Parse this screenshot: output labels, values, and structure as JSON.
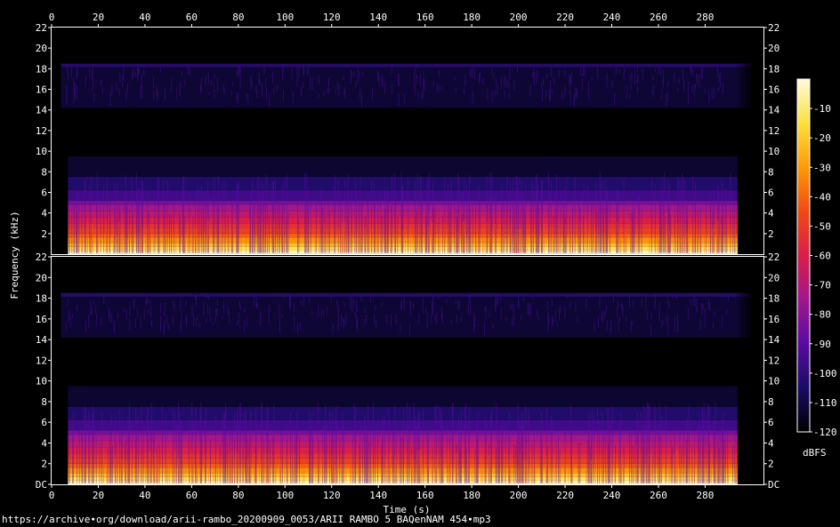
{
  "chart_data": {
    "type": "heatmap",
    "title": "",
    "xlabel": "Time (s)",
    "ylabel": "Frequency (kHz)",
    "xlim": [
      0,
      305
    ],
    "x_ticks": [
      0,
      20,
      40,
      60,
      80,
      100,
      120,
      140,
      160,
      180,
      200,
      220,
      240,
      260,
      280
    ],
    "channels": [
      {
        "name": "upper",
        "ylim": [
          0,
          22
        ],
        "y_ticks": [
          "2",
          "4",
          "6",
          "8",
          "10",
          "12",
          "14",
          "16",
          "18",
          "20",
          "22"
        ],
        "y_ticks_right": [
          "2",
          "4",
          "6",
          "8",
          "10",
          "12",
          "14",
          "16",
          "18",
          "20",
          "22"
        ]
      },
      {
        "name": "lower",
        "ylim": [
          0,
          22
        ],
        "y_ticks": [
          "DC",
          "2",
          "4",
          "6",
          "8",
          "10",
          "12",
          "14",
          "16",
          "18",
          "20",
          "22"
        ],
        "y_ticks_right": [
          "DC",
          "2",
          "4",
          "6",
          "8",
          "10",
          "12",
          "14",
          "16",
          "18",
          "20",
          "22"
        ]
      }
    ],
    "audio_start_s": 4,
    "audio_end_s": 302,
    "lowpass_khz": 18.5,
    "colorbar": {
      "label": "dBFS",
      "range": [
        -120,
        0
      ],
      "ticks": [
        "-10",
        "-20",
        "-30",
        "-40",
        "-50",
        "-60",
        "-70",
        "-80",
        "-90",
        "-100",
        "-110",
        "-120"
      ],
      "colors": [
        "#000000",
        "#1a0c64",
        "#5a0ba0",
        "#a0188c",
        "#d81e4a",
        "#f04a16",
        "#fc9a0a",
        "#fde040",
        "#fffadc"
      ]
    }
  },
  "footer": {
    "source_url": "https://archive∙org/download/arii-rambo_20200909_0053/ARII RAMBO 5 BAQenNAM 454∙mp3"
  }
}
